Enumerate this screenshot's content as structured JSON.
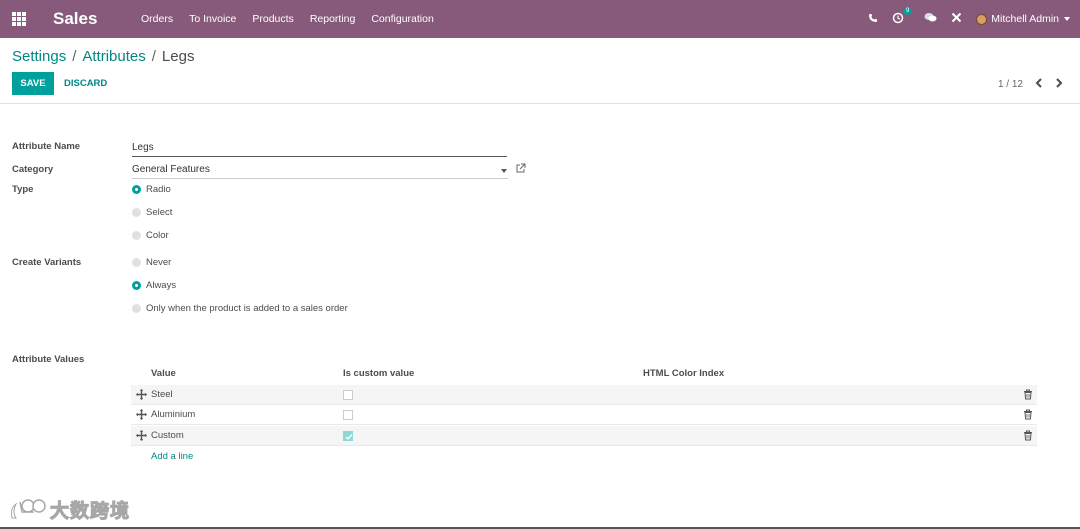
{
  "navbar": {
    "app_title": "Sales",
    "menu": [
      "Orders",
      "To Invoice",
      "Products",
      "Reporting",
      "Configuration"
    ],
    "activity_count": "9",
    "user_name": "Mitchell Admin",
    "bg_color": "#875a7b"
  },
  "breadcrumb": {
    "root": "Settings",
    "parent": "Attributes",
    "current": "Legs",
    "sep": "/"
  },
  "buttons": {
    "save": "SAVE",
    "discard": "DISCARD"
  },
  "pager": {
    "value": "1 / 12"
  },
  "form": {
    "name_label": "Attribute Name",
    "name_value": "Legs",
    "category_label": "Category",
    "category_value": "General Features",
    "type_label": "Type",
    "type_options": [
      "Radio",
      "Select",
      "Color"
    ],
    "type_selected": "Radio",
    "variants_label": "Create Variants",
    "variants_options": [
      "Never",
      "Always",
      "Only when the product is added to a sales order"
    ],
    "variants_selected": "Always",
    "values_label": "Attribute Values"
  },
  "table": {
    "headers": [
      "Value",
      "Is custom value",
      "HTML Color Index"
    ],
    "rows": [
      {
        "value": "Steel",
        "is_custom": false
      },
      {
        "value": "Aluminium",
        "is_custom": false
      },
      {
        "value": "Custom",
        "is_custom": true
      }
    ],
    "add_line": "Add a line"
  },
  "watermark": {
    "text": "大数跨境"
  },
  "icons": {
    "apps": "apps-grid-icon",
    "phone": "phone-icon",
    "activity": "clock-icon",
    "messages": "chat-icon",
    "debug": "tools-icon",
    "external": "external-link-icon",
    "handle": "move-handle-icon",
    "delete": "trash-icon"
  },
  "accent_color": "#00a09d"
}
